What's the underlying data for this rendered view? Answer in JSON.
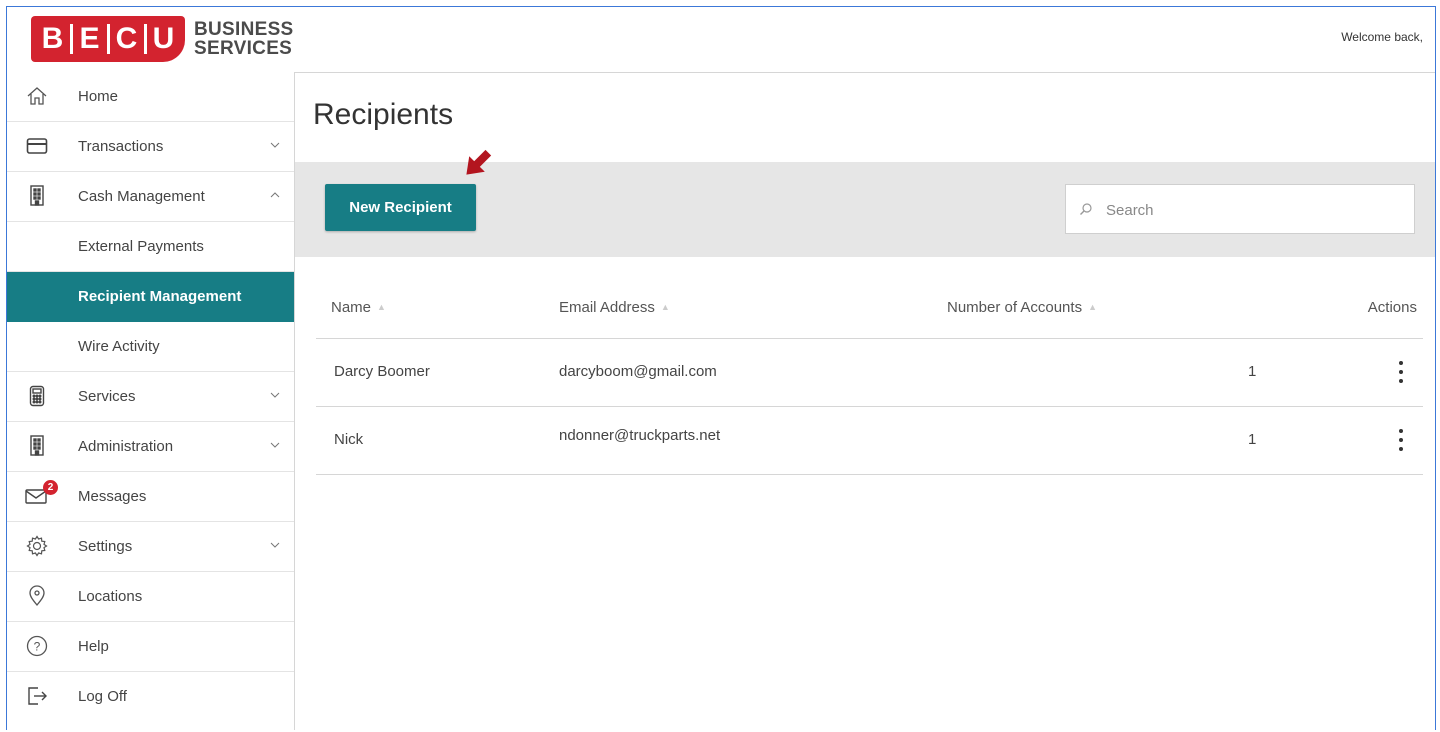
{
  "header": {
    "logo_letters": [
      "B",
      "E",
      "C",
      "U"
    ],
    "logo_line1": "BUSINESS",
    "logo_line2": "SERVICES",
    "welcome": "Welcome back, "
  },
  "sidebar": {
    "items": [
      {
        "label": "Home",
        "icon": "home-icon"
      },
      {
        "label": "Transactions",
        "icon": "credit-card-icon"
      },
      {
        "label": "Cash Management",
        "icon": "building-icon"
      },
      {
        "label": "External Payments"
      },
      {
        "label": "Recipient Management"
      },
      {
        "label": "Wire Activity"
      },
      {
        "label": "Services",
        "icon": "calculator-icon"
      },
      {
        "label": "Administration",
        "icon": "building-icon"
      },
      {
        "label": "Messages",
        "icon": "envelope-icon",
        "badge": "2"
      },
      {
        "label": "Settings",
        "icon": "gear-icon"
      },
      {
        "label": "Locations",
        "icon": "location-pin-icon"
      },
      {
        "label": "Help",
        "icon": "help-icon"
      },
      {
        "label": "Log Off",
        "icon": "log-off-icon"
      }
    ]
  },
  "main": {
    "title": "Recipients",
    "new_button": "New Recipient",
    "search_placeholder": "Search",
    "columns": {
      "name": "Name",
      "email": "Email Address",
      "accounts": "Number of Accounts",
      "actions": "Actions"
    },
    "rows": [
      {
        "name": "Darcy Boomer",
        "email": "darcyboom@gmail.com",
        "accounts": "1"
      },
      {
        "name": "Nick",
        "email": "ndonner@truckparts.net",
        "accounts": "1"
      }
    ]
  },
  "colors": {
    "brand_red": "#d3232f",
    "teal": "#177d85",
    "annotation_arrow": "#b3151f"
  }
}
